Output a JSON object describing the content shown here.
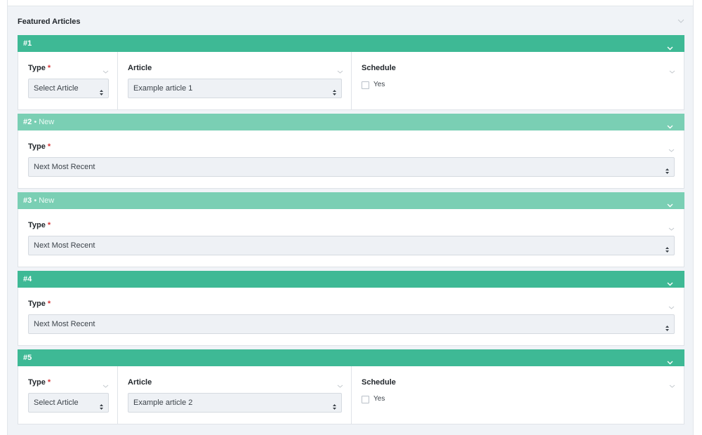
{
  "section": {
    "title": "Featured Articles"
  },
  "labels": {
    "type": "Type",
    "required_mark": "*",
    "article": "Article",
    "schedule": "Schedule",
    "yes": "Yes",
    "new_tag": "• New"
  },
  "rows": [
    {
      "title": "#1",
      "is_new": false,
      "layout": "full",
      "type_value": "Select Article",
      "article_value": "Example article 1",
      "schedule_checked": false
    },
    {
      "title": "#2",
      "is_new": true,
      "layout": "type-only",
      "type_value": "Next Most Recent"
    },
    {
      "title": "#3",
      "is_new": true,
      "layout": "type-only",
      "type_value": "Next Most Recent"
    },
    {
      "title": "#4",
      "is_new": false,
      "layout": "type-only",
      "type_value": "Next Most Recent"
    },
    {
      "title": "#5",
      "is_new": false,
      "layout": "full",
      "type_value": "Select Article",
      "article_value": "Example article 2",
      "schedule_checked": false
    }
  ],
  "colors": {
    "bar": "#3eb995",
    "bar_new": "#7acfb4",
    "required": "#d63638",
    "panel_bg": "#f0f3f7"
  },
  "icons": {
    "collapse": "chevron-down-icon",
    "select_arrows": "sort-arrows-icon"
  }
}
